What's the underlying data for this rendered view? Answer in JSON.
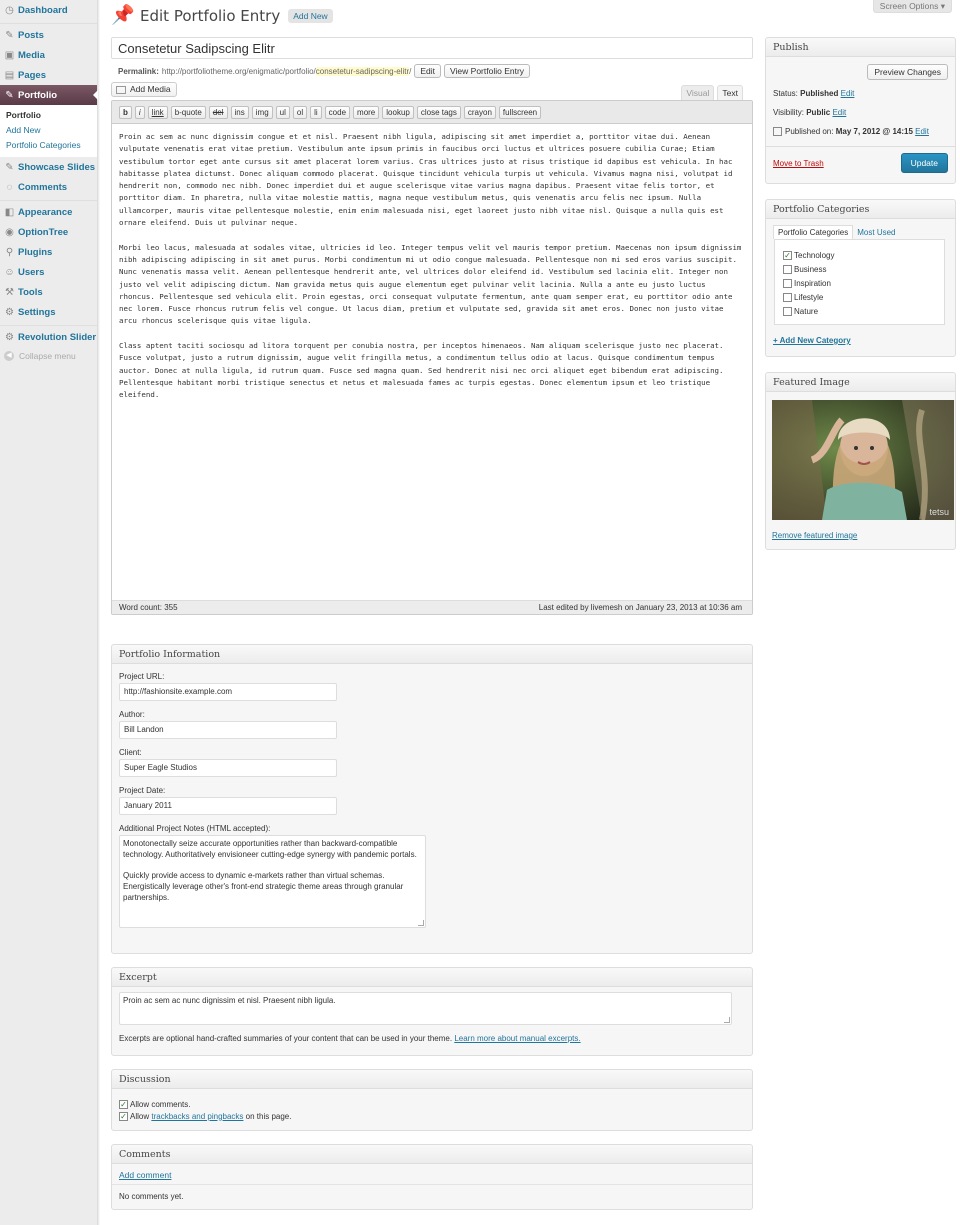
{
  "sidebar": {
    "items": [
      {
        "label": "Dashboard",
        "icon": "dashboard-icon",
        "glyph": "◷"
      },
      {
        "label": "Posts",
        "icon": "pin-icon",
        "glyph": "✎"
      },
      {
        "label": "Media",
        "icon": "media-icon",
        "glyph": "▣"
      },
      {
        "label": "Pages",
        "icon": "pages-icon",
        "glyph": "▤"
      },
      {
        "label": "Portfolio",
        "icon": "pin-icon",
        "glyph": "✎"
      },
      {
        "label": "Showcase Slides",
        "icon": "pin-icon",
        "glyph": "✎"
      },
      {
        "label": "Comments",
        "icon": "comment-icon",
        "glyph": "◌"
      },
      {
        "label": "Appearance",
        "icon": "appearance-icon",
        "glyph": "◧"
      },
      {
        "label": "OptionTree",
        "icon": "optiontree-icon",
        "glyph": "◉"
      },
      {
        "label": "Plugins",
        "icon": "plugin-icon",
        "glyph": "⚲"
      },
      {
        "label": "Users",
        "icon": "users-icon",
        "glyph": "☺"
      },
      {
        "label": "Tools",
        "icon": "tools-icon",
        "glyph": "⚒"
      },
      {
        "label": "Settings",
        "icon": "settings-icon",
        "glyph": "⚙"
      },
      {
        "label": "Revolution Slider",
        "icon": "gear-icon",
        "glyph": "⚙"
      }
    ],
    "portfolio_submenu": [
      "Portfolio",
      "Add New",
      "Portfolio Categories"
    ],
    "collapse_label": "Collapse menu"
  },
  "header": {
    "screen_options": "Screen Options ▾",
    "title": "Edit Portfolio Entry",
    "add_new": "Add New"
  },
  "post": {
    "title": "Consetetur Sadipscing Elitr",
    "permalink_label": "Permalink:",
    "permalink_base": "http://portfoliotheme.org/enigmatic/portfolio/",
    "permalink_slug": "consetetur-sadipscing-elitr",
    "permalink_trail": "/",
    "edit_btn": "Edit",
    "view_btn": "View Portfolio Entry"
  },
  "editor": {
    "add_media": "Add Media",
    "tab_visual": "Visual",
    "tab_text": "Text",
    "toolbar": [
      "b",
      "i",
      "link",
      "b-quote",
      "del",
      "ins",
      "img",
      "ul",
      "ol",
      "li",
      "code",
      "more",
      "lookup",
      "close tags",
      "crayon",
      "fullscreen"
    ],
    "paragraphs": [
      "Proin ac sem ac nunc dignissim congue et et nisl. Praesent nibh ligula, adipiscing sit amet imperdiet a, porttitor vitae dui. Aenean vulputate venenatis erat vitae pretium. Vestibulum ante ipsum primis in faucibus orci luctus et ultrices posuere cubilia Curae; Etiam vestibulum tortor eget ante cursus sit amet placerat lorem varius. Cras ultrices justo at risus tristique id dapibus est vehicula. In hac habitasse platea dictumst. Donec aliquam commodo placerat. Quisque tincidunt vehicula turpis ut vehicula. Vivamus magna nisi, volutpat id hendrerit non, commodo nec nibh. Donec imperdiet dui et augue scelerisque vitae varius magna dapibus. Praesent vitae felis tortor, et porttitor diam. In pharetra, nulla vitae molestie mattis, magna neque vestibulum metus, quis venenatis arcu felis nec ipsum. Nulla ullamcorper, mauris vitae pellentesque molestie, enim enim malesuada nisi, eget laoreet justo nibh vitae nisl. Quisque a nulla quis est ornare eleifend. Duis ut pulvinar neque.",
      "Morbi leo lacus, malesuada at sodales vitae, ultricies id leo. Integer tempus velit vel mauris tempor pretium. Maecenas non ipsum dignissim nibh adipiscing adipiscing in sit amet purus. Morbi condimentum mi ut odio congue malesuada. Pellentesque non mi sed eros varius suscipit. Nunc venenatis massa velit. Aenean pellentesque hendrerit ante, vel ultrices dolor eleifend id. Vestibulum sed lacinia elit. Integer non justo vel velit adipiscing dictum. Nam gravida metus quis augue elementum eget pulvinar velit lacinia. Nulla a ante eu justo luctus rhoncus. Pellentesque sed vehicula elit. Proin egestas, orci consequat vulputate fermentum, ante quam semper erat, eu porttitor odio ante nec lorem. Fusce rhoncus rutrum felis vel congue. Ut lacus diam, pretium et vulputate sed, gravida sit amet eros. Donec non justo vitae arcu rhoncus scelerisque quis vitae ligula.",
      "Class aptent taciti sociosqu ad litora torquent per conubia nostra, per inceptos himenaeos. Nam aliquam scelerisque justo nec placerat. Fusce volutpat, justo a rutrum dignissim, augue velit fringilla metus, a condimentum tellus odio at lacus. Quisque condimentum tempus auctor. Donec at nulla ligula, id rutrum quam. Fusce sed magna quam. Sed hendrerit nisi nec orci aliquet eget bibendum erat adipiscing. Pellentesque habitant morbi tristique senectus et netus et malesuada fames ac turpis egestas. Donec elementum ipsum et leo tristique eleifend."
    ],
    "word_count": "Word count: 355",
    "last_edited": "Last edited by livemesh on January 23, 2013 at 10:36 am"
  },
  "portfolio_info": {
    "heading": "Portfolio Information",
    "project_url_label": "Project URL:",
    "project_url": "http://fashionsite.example.com",
    "author_label": "Author:",
    "author": "Bill Landon",
    "client_label": "Client:",
    "client": "Super Eagle Studios",
    "date_label": "Project Date:",
    "date": "January 2011",
    "notes_label": "Additional Project Notes (HTML accepted):",
    "notes_p1": "Monotonectally seize accurate opportunities rather than backward-compatible technology. Authoritatively envisioneer cutting-edge synergy with pandemic portals.",
    "notes_p2": "Quickly provide access to dynamic e-markets rather than virtual schemas. Energistically leverage other's front-end strategic theme areas through granular partnerships."
  },
  "excerpt": {
    "heading": "Excerpt",
    "value": "Proin ac sem ac nunc dignissim et nisl. Praesent nibh ligula.",
    "help": "Excerpts are optional hand-crafted summaries of your content that can be used in your theme.",
    "help_link": "Learn more about manual excerpts."
  },
  "discussion": {
    "heading": "Discussion",
    "allow_comments": "Allow comments.",
    "allow_prefix": "Allow",
    "trackbacks_link": "trackbacks and pingbacks",
    "allow_suffix": "on this page."
  },
  "comments": {
    "heading": "Comments",
    "add_link": "Add comment",
    "none": "No comments yet."
  },
  "publish": {
    "heading": "Publish",
    "preview": "Preview Changes",
    "status_label": "Status:",
    "status": "Published",
    "visibility_label": "Visibility:",
    "visibility": "Public",
    "published_label": "Published on:",
    "published": "May 7, 2012 @ 14:15",
    "edit": "Edit",
    "trash": "Move to Trash",
    "update": "Update"
  },
  "categories": {
    "heading": "Portfolio Categories",
    "tab_all": "Portfolio Categories",
    "tab_most": "Most Used",
    "items": [
      {
        "label": "Technology",
        "checked": "✓"
      },
      {
        "label": "Business",
        "checked": ""
      },
      {
        "label": "Inspiration",
        "checked": ""
      },
      {
        "label": "Lifestyle",
        "checked": ""
      },
      {
        "label": "Nature",
        "checked": ""
      }
    ],
    "add_new": "+ Add New Category"
  },
  "featured": {
    "heading": "Featured Image",
    "watermark": "tetsu",
    "remove": "Remove featured image"
  },
  "colors": {
    "accent": "#21759b",
    "menu_current": "#6a4754",
    "trash": "#bc0b0b"
  }
}
